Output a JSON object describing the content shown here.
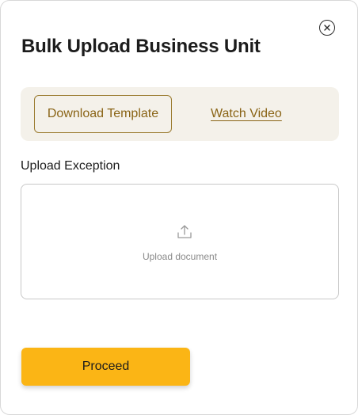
{
  "dialog": {
    "title": "Bulk Upload Business Unit",
    "close_icon": "close-circle-icon"
  },
  "toolbar": {
    "download_template_label": "Download Template",
    "watch_video_label": "Watch Video"
  },
  "upload": {
    "section_label": "Upload Exception",
    "icon": "upload-icon",
    "placeholder": "Upload document"
  },
  "actions": {
    "proceed_label": "Proceed"
  },
  "colors": {
    "accent": "#fbb515",
    "link": "#8a6416",
    "toolbar_bg": "#f4f1ea"
  }
}
